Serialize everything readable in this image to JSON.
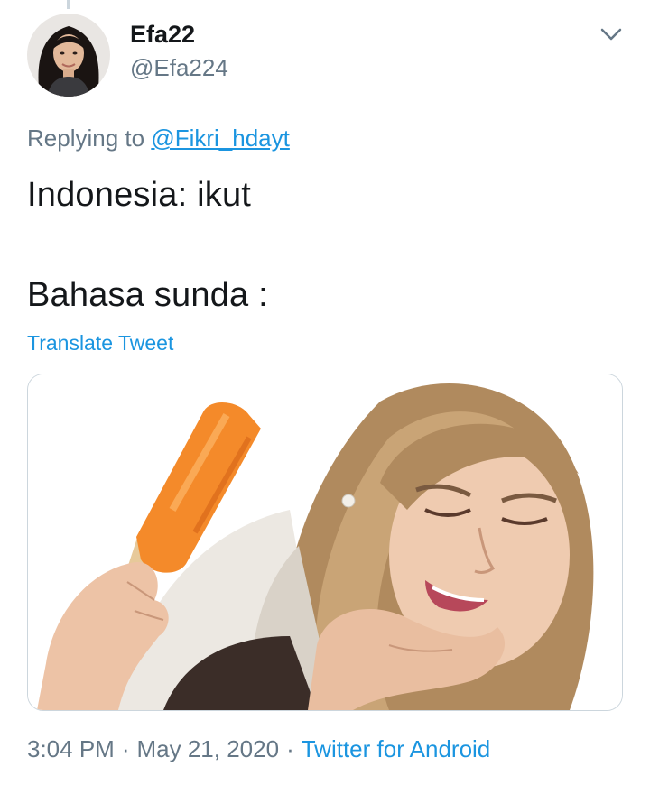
{
  "author": {
    "display_name": "Efa22",
    "handle": "@Efa224"
  },
  "reply": {
    "prefix": "Replying to",
    "mention": "@Fikri_hdayt"
  },
  "content": {
    "lines": [
      "Indonesia: ikut",
      "Bahasa sunda :"
    ]
  },
  "translate_label": "Translate Tweet",
  "meta": {
    "time": "3:04 PM",
    "separator": "·",
    "date": "May 21, 2020",
    "source": "Twitter for Android"
  },
  "colors": {
    "link": "#1b95e0",
    "secondary_text": "#657786",
    "primary_text": "#14171a",
    "border": "#ccd6dd"
  },
  "icons": {
    "menu": "chevron-down-icon"
  }
}
